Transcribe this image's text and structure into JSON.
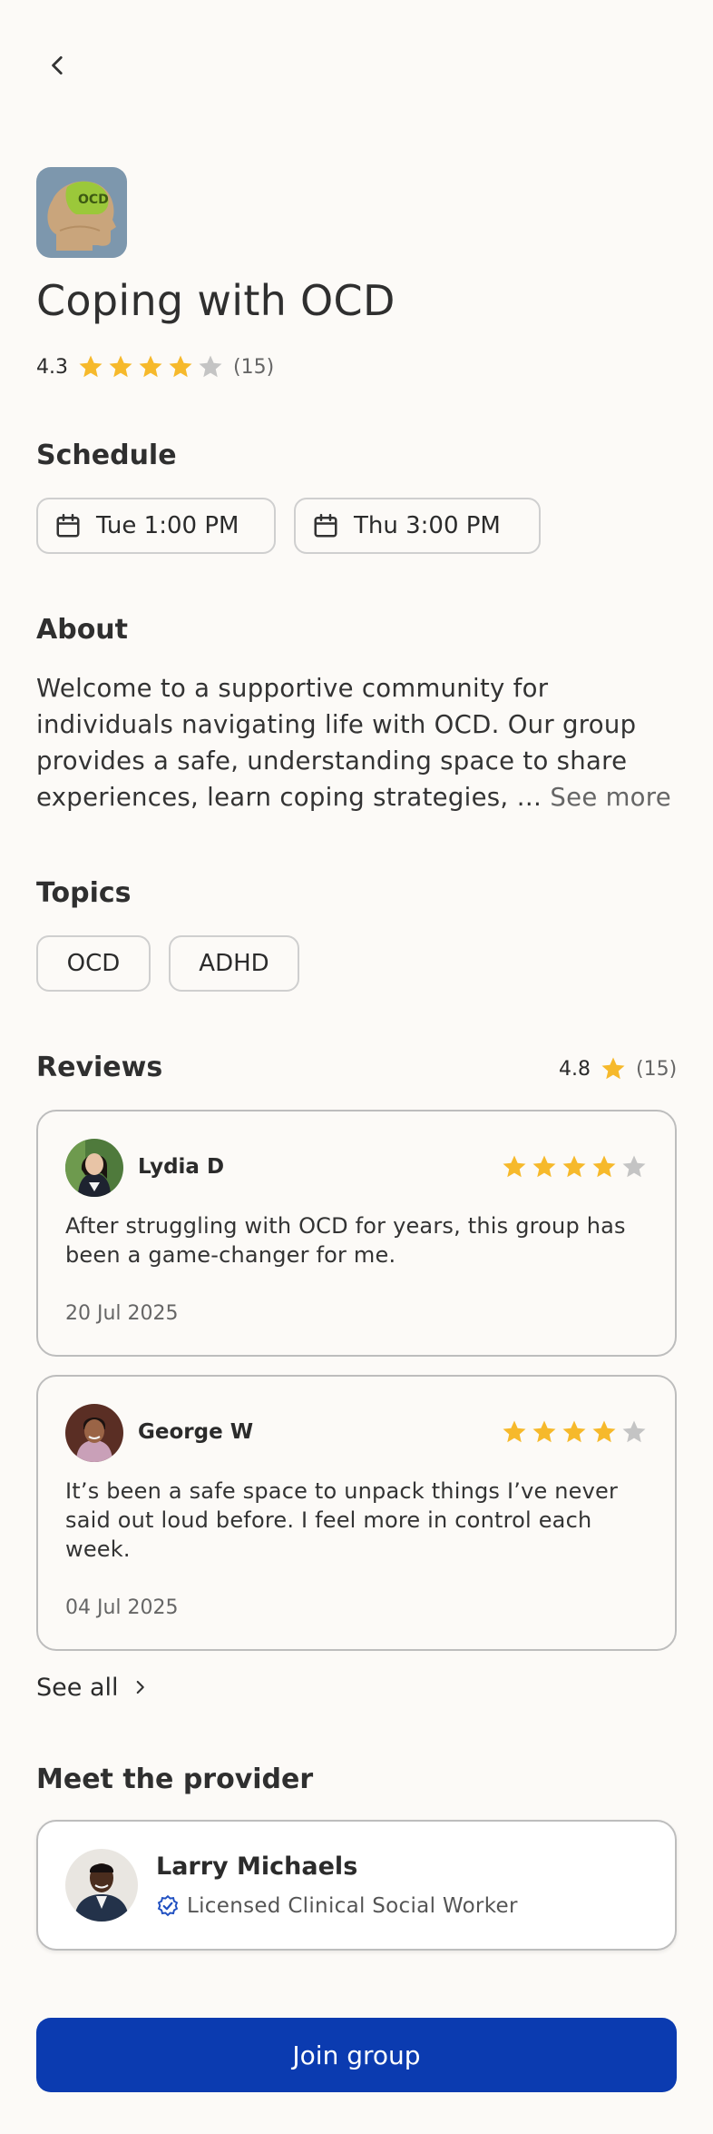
{
  "group": {
    "title": "Coping with OCD",
    "rating": "4.3",
    "rating_value": 4.3,
    "rating_count": "(15)",
    "image_label": "OCD"
  },
  "schedule": {
    "heading": "Schedule",
    "slots": [
      "Tue 1:00 PM",
      "Thu 3:00 PM"
    ]
  },
  "about": {
    "heading": "About",
    "text": "Welcome to a supportive community for individuals navigating life with OCD. Our group provides a safe, understanding space to share experiences, learn coping strategies, …",
    "see_more": "See more"
  },
  "topics": {
    "heading": "Topics",
    "items": [
      "OCD",
      "ADHD"
    ]
  },
  "reviews": {
    "heading": "Reviews",
    "rating": "4.8",
    "count": "(15)",
    "items": [
      {
        "name": "Lydia D",
        "stars": 4,
        "text": "After struggling with OCD for years, this group has been a game-changer for me.",
        "date": "20 Jul 2025"
      },
      {
        "name": "George W",
        "stars": 4,
        "text": "It’s been a safe space to unpack things I’ve never said out loud before. I feel more in control each week.",
        "date": "04 Jul 2025"
      }
    ],
    "see_all": "See all"
  },
  "provider": {
    "heading": "Meet the provider",
    "name": "Larry Michaels",
    "credential": "Licensed Clinical Social Worker"
  },
  "cta": {
    "join_label": "Join group"
  },
  "colors": {
    "background": "#fcfaf7",
    "accent": "#0b3bb0",
    "star_filled": "#f6b92b",
    "star_empty": "#c4c4c4",
    "verified": "#1f4fc1"
  },
  "icons": [
    "chevron-left-icon",
    "calendar-icon",
    "star-icon",
    "chevron-right-icon",
    "verified-badge-icon"
  ]
}
